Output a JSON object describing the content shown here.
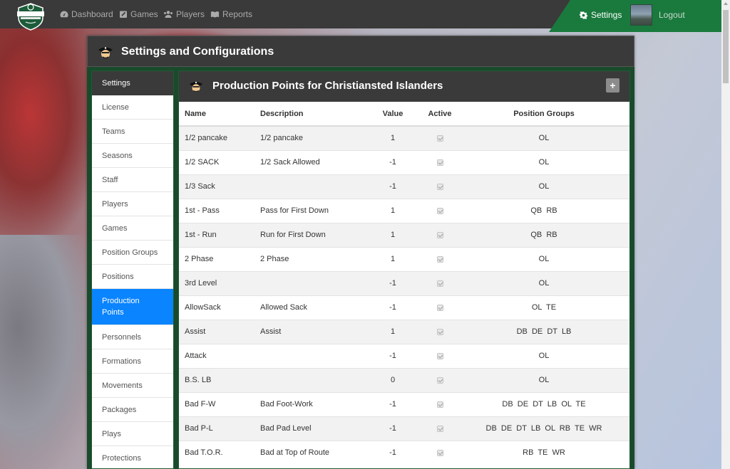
{
  "nav": {
    "dashboard_label": "Dashboard",
    "games_label": "Games",
    "players_label": "Players",
    "reports_label": "Reports",
    "settings_label": "Settings",
    "logout_label": "Logout",
    "accent_color": "#1a7a3e"
  },
  "panel": {
    "title": "Settings and Configurations"
  },
  "sidebar": {
    "header": "Settings",
    "items": [
      {
        "label": "License"
      },
      {
        "label": "Teams"
      },
      {
        "label": "Seasons"
      },
      {
        "label": "Staff"
      },
      {
        "label": "Players"
      },
      {
        "label": "Games"
      },
      {
        "label": "Position Groups"
      },
      {
        "label": "Positions"
      },
      {
        "label": "Production Points"
      },
      {
        "label": "Personnels"
      },
      {
        "label": "Formations"
      },
      {
        "label": "Movements"
      },
      {
        "label": "Packages"
      },
      {
        "label": "Plays"
      },
      {
        "label": "Protections"
      }
    ],
    "active_color": "#0a84ff"
  },
  "content": {
    "title": "Production Points for Christiansted Islanders",
    "add_label": "+",
    "columns": [
      "Name",
      "Description",
      "Value",
      "Active",
      "Position Groups"
    ],
    "rows": [
      {
        "name": "1/2 pancake",
        "description": "1/2 pancake",
        "value": "1",
        "active": true,
        "groups": "OL"
      },
      {
        "name": "1/2 SACK",
        "description": "1/2 Sack Allowed",
        "value": "-1",
        "active": true,
        "groups": "OL"
      },
      {
        "name": "1/3 Sack",
        "description": "",
        "value": "-1",
        "active": true,
        "groups": "OL"
      },
      {
        "name": "1st - Pass",
        "description": "Pass for First Down",
        "value": "1",
        "active": true,
        "groups": "QB  RB"
      },
      {
        "name": "1st - Run",
        "description": "Run for First Down",
        "value": "1",
        "active": true,
        "groups": "QB  RB"
      },
      {
        "name": "2 Phase",
        "description": "2 Phase",
        "value": "1",
        "active": true,
        "groups": "OL"
      },
      {
        "name": "3rd Level",
        "description": "",
        "value": "-1",
        "active": true,
        "groups": "OL"
      },
      {
        "name": "AllowSack",
        "description": "Allowed Sack",
        "value": "-1",
        "active": true,
        "groups": "OL  TE"
      },
      {
        "name": "Assist",
        "description": "Assist",
        "value": "1",
        "active": true,
        "groups": "DB  DE  DT  LB"
      },
      {
        "name": "Attack",
        "description": "",
        "value": "-1",
        "active": true,
        "groups": "OL"
      },
      {
        "name": "B.S. LB",
        "description": "",
        "value": "0",
        "active": true,
        "groups": "OL"
      },
      {
        "name": "Bad F-W",
        "description": "Bad Foot-Work",
        "value": "-1",
        "active": true,
        "groups": "DB  DE  DT  LB  OL  TE"
      },
      {
        "name": "Bad P-L",
        "description": "Bad Pad Level",
        "value": "-1",
        "active": true,
        "groups": "DB  DE  DT  LB  OL  RB  TE  WR"
      },
      {
        "name": "Bad T.O.R.",
        "description": "Bad at Top of Route",
        "value": "-1",
        "active": true,
        "groups": "RB  TE  WR"
      }
    ]
  }
}
